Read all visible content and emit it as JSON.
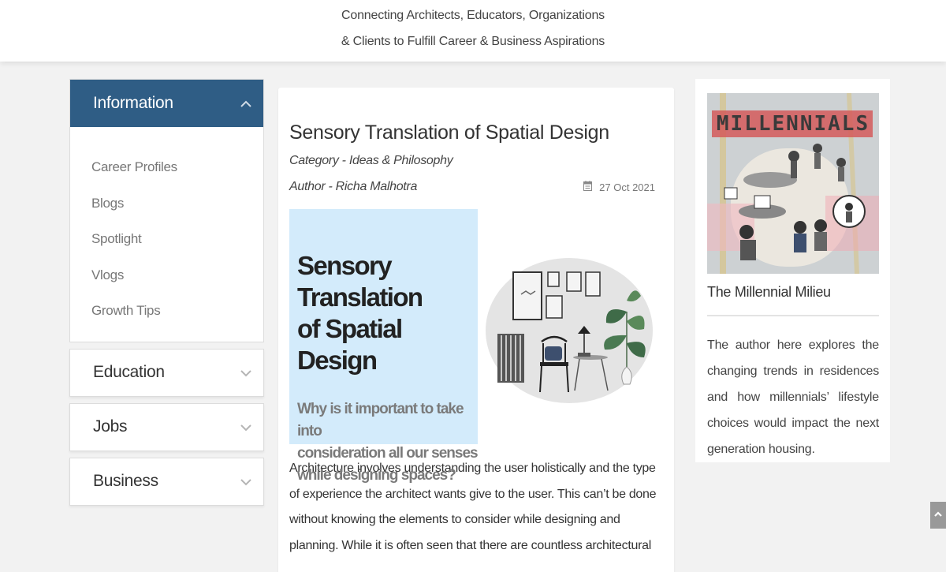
{
  "header": {
    "tagline_line1": "Connecting Architects, Educators, Organizations",
    "tagline_line2": "& Clients to Fulfill Career & Business Aspirations"
  },
  "sidebar": {
    "open_section": {
      "title": "Information",
      "items": [
        "Career Profiles",
        "Blogs",
        "Spotlight",
        "Vlogs",
        "Growth Tips"
      ]
    },
    "closed_sections": [
      "Education",
      "Jobs",
      "Business"
    ]
  },
  "article": {
    "title": "Sensory Translation of Spatial Design",
    "category": "Category - Ideas & Philosophy",
    "author": "Author - Richa Malhotra",
    "date": "27 Oct 2021",
    "hero_heading_line1": "Sensory Translation",
    "hero_heading_line2": "of Spatial Design",
    "hero_sub_line1": "Why is it important to take into",
    "hero_sub_line2": "consideration all our senses",
    "hero_sub_line3": "while designing spaces?",
    "body_line1": "Architecture involves understanding the user holistically and the type",
    "body_line2": "of experience the architect wants give to the user. This can’t be done",
    "body_line3": "without knowing the elements to consider while designing and",
    "body_line4": "planning. While it is often seen that there are countless architectural"
  },
  "related": {
    "image_label": "MILLENNIALS",
    "title": "The Millennial Milieu",
    "excerpt": "The author here explores the changing trends in residences and how millennials’ lifestyle choices would impact the next generation housing."
  },
  "colors": {
    "accent": "#2f5d85",
    "hero_background": "#d3ebfb",
    "page_background": "#f2f2f2"
  },
  "icons": {
    "open_chevron": "chevron-up-icon",
    "closed_chevron": "chevron-down-icon",
    "date": "calendar-icon",
    "scroll": "arrow-up-icon"
  }
}
